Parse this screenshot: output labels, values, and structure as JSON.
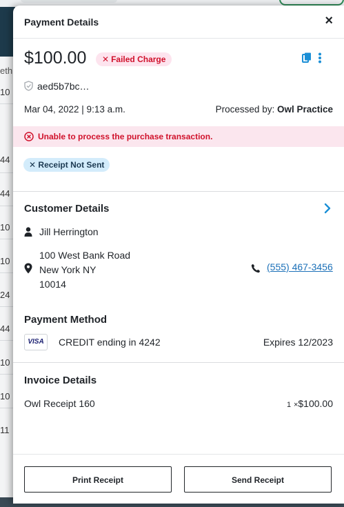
{
  "background": {
    "cells": [
      "eth",
      "10",
      "44",
      "44",
      "10",
      "10",
      "24",
      "44",
      "10",
      "10",
      "11"
    ]
  },
  "drawer": {
    "title": "Payment Details",
    "close_symbol": "×",
    "amount": "$100.00",
    "status_badge": "Failed Charge",
    "transaction_id": "aed5b7bc…",
    "date": "Mar 04, 2022 | 9:13 a.m.",
    "processed_by_label": "Processed by: ",
    "processed_by": "Owl Practice",
    "error_message": "Unable to process the purchase transaction.",
    "receipt_badge": "Receipt Not Sent",
    "colors": {
      "error_red": "#d0112b",
      "error_bg": "#fbe6ee",
      "link_blue": "#1b70b8",
      "receipt_badge_bg": "#d3ecfb"
    }
  },
  "customer": {
    "section_title": "Customer Details",
    "name": "Jill Herrington",
    "address_line1": "100 West Bank Road",
    "address_line2": "New York NY",
    "address_line3": "10014",
    "phone": "(555) 467-3456"
  },
  "payment_method": {
    "section_title": "Payment Method",
    "card_brand": "VISA",
    "card_description": "CREDIT ending in 4242",
    "expires": "Expires 12/2023"
  },
  "invoice": {
    "section_title": "Invoice Details",
    "item_name": "Owl Receipt 160",
    "quantity": "1",
    "multiplier": "×",
    "item_amount": "$100.00"
  },
  "footer": {
    "print_label": "Print Receipt",
    "send_label": "Send Receipt"
  }
}
